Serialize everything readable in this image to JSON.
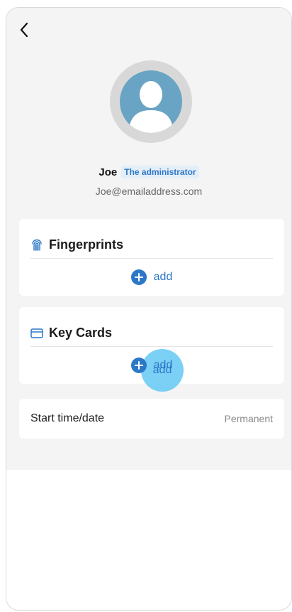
{
  "header": {
    "back_icon": "chevron-left-icon"
  },
  "profile": {
    "name": "Joe",
    "role": "The administrator",
    "email": "Joe@emailaddress.com",
    "avatar_icon": "user-avatar-icon"
  },
  "fingerprints": {
    "icon": "fingerprint-icon",
    "title": "Fingerprints",
    "add_label": "add"
  },
  "key_cards": {
    "icon": "card-icon",
    "title": "Key Cards",
    "add_label": "add"
  },
  "start": {
    "label": "Start time/date",
    "value": "Permanent"
  },
  "colors": {
    "accent": "#2d77c7",
    "badge_bg": "#e3eef8",
    "avatar_bg": "#6aa4c4",
    "tap_highlight": "#64c8f5",
    "background": "#f4f4f4"
  }
}
